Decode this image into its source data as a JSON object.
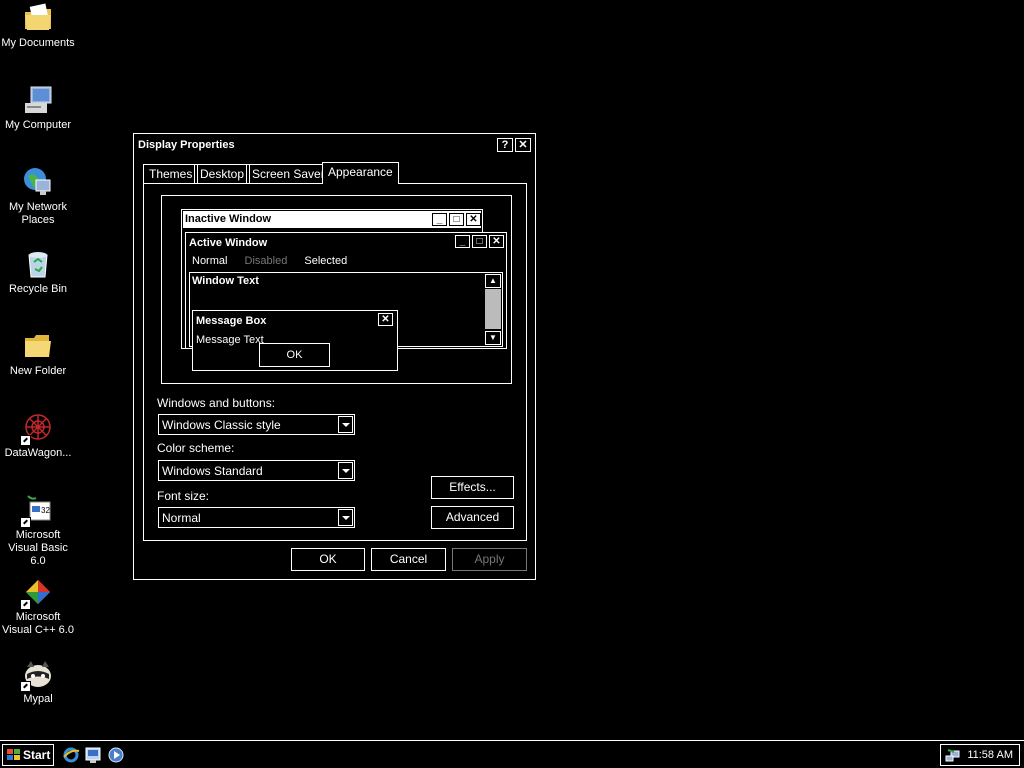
{
  "desktop": {
    "icons": [
      {
        "label": "My Documents",
        "icon": "my-documents-icon"
      },
      {
        "label": "My Computer",
        "icon": "my-computer-icon"
      },
      {
        "label": "My Network Places",
        "icon": "network-places-icon"
      },
      {
        "label": "Recycle Bin",
        "icon": "recycle-bin-icon"
      },
      {
        "label": "New Folder",
        "icon": "folder-icon"
      },
      {
        "label": "DataWagon...",
        "icon": "datawagon-icon"
      },
      {
        "label": "Microsoft Visual Basic 6.0",
        "icon": "visual-basic-icon"
      },
      {
        "label": "Microsoft Visual C++ 6.0",
        "icon": "visual-cpp-icon"
      },
      {
        "label": "Mypal",
        "icon": "mypal-icon"
      }
    ]
  },
  "dialog": {
    "title": "Display Properties",
    "help_glyph": "?",
    "close_glyph": "✕",
    "tabs": [
      {
        "label": "Themes"
      },
      {
        "label": "Desktop"
      },
      {
        "label": "Screen Saver"
      },
      {
        "label": "Appearance",
        "active": true
      }
    ],
    "preview": {
      "inactive_title": "Inactive Window",
      "active_title": "Active Window",
      "menu_normal": "Normal",
      "menu_disabled": "Disabled",
      "menu_selected": "Selected",
      "window_text": "Window Text",
      "msgbox_title": "Message Box",
      "msgbox_text": "Message Text",
      "msgbox_ok": "OK"
    },
    "windows_buttons_label": "Windows and buttons:",
    "windows_buttons_value": "Windows Classic style",
    "color_scheme_label": "Color scheme:",
    "color_scheme_value": "Windows Standard",
    "font_size_label": "Font size:",
    "font_size_value": "Normal",
    "effects_button": "Effects...",
    "advanced_button": "Advanced",
    "ok_button": "OK",
    "cancel_button": "Cancel",
    "apply_button": "Apply"
  },
  "taskbar": {
    "start_label": "Start",
    "quick_launch": [
      "internet-explorer-icon",
      "desktop-icon",
      "media-player-icon"
    ],
    "clock": "11:58 AM"
  },
  "colors": {
    "background": "#000000",
    "foreground": "#ffffff",
    "disabled": "#777777"
  }
}
